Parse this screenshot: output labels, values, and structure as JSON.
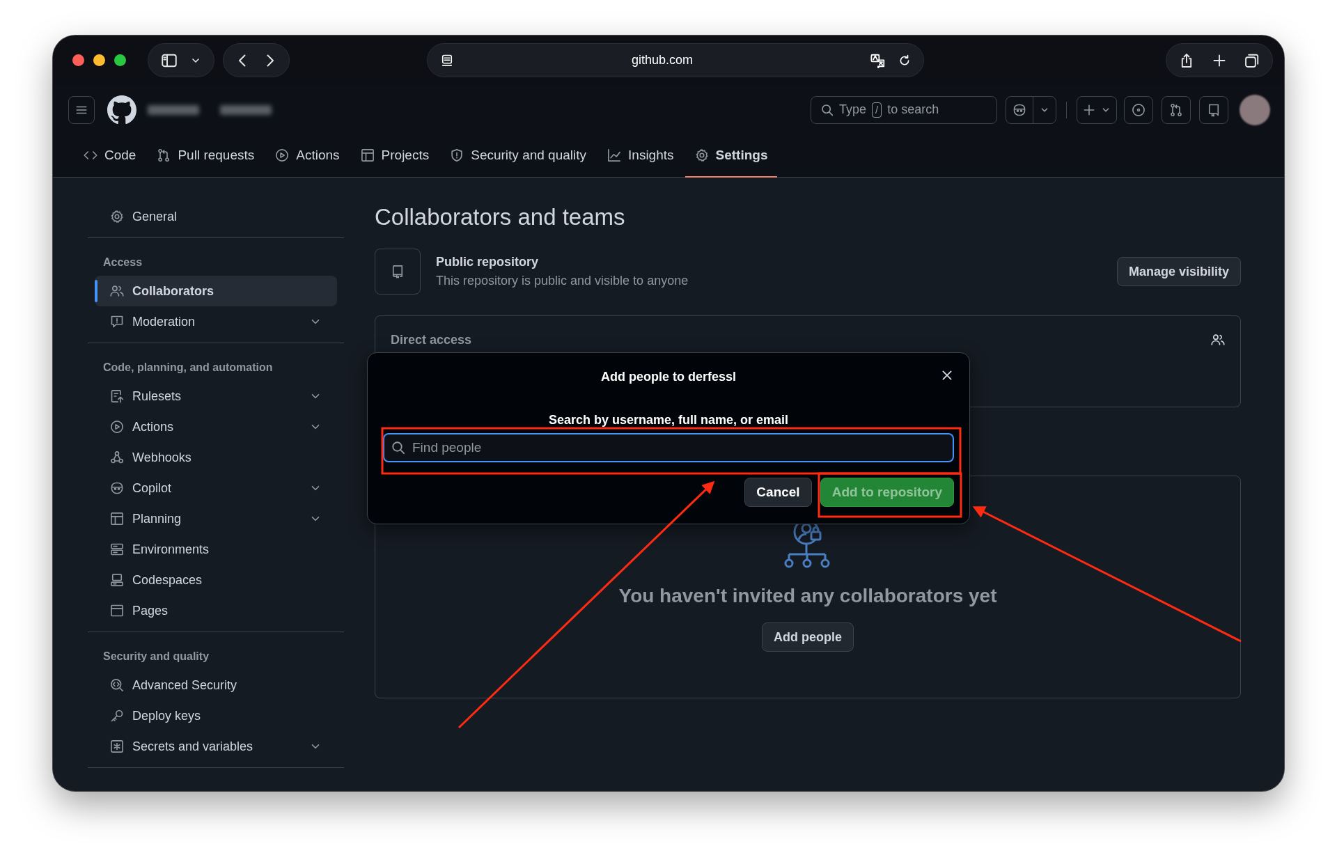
{
  "browser": {
    "url": "github.com"
  },
  "header": {
    "search": {
      "before": "Type",
      "key": "/",
      "after": "to search"
    }
  },
  "repo_nav": [
    {
      "label": "Code",
      "selected": false
    },
    {
      "label": "Pull requests",
      "selected": false
    },
    {
      "label": "Actions",
      "selected": false
    },
    {
      "label": "Projects",
      "selected": false
    },
    {
      "label": "Security and quality",
      "selected": false
    },
    {
      "label": "Insights",
      "selected": false
    },
    {
      "label": "Settings",
      "selected": true
    }
  ],
  "sidebar": {
    "sections": [
      {
        "items": [
          {
            "label": "General",
            "selected": false,
            "has_submenu": false
          }
        ]
      },
      {
        "heading": "Access",
        "items": [
          {
            "label": "Collaborators",
            "selected": true,
            "has_submenu": false
          },
          {
            "label": "Moderation",
            "selected": false,
            "has_submenu": true
          }
        ]
      },
      {
        "heading": "Code, planning, and automation",
        "items": [
          {
            "label": "Rulesets",
            "selected": false,
            "has_submenu": true
          },
          {
            "label": "Actions",
            "selected": false,
            "has_submenu": true
          },
          {
            "label": "Webhooks",
            "selected": false,
            "has_submenu": false
          },
          {
            "label": "Copilot",
            "selected": false,
            "has_submenu": true
          },
          {
            "label": "Planning",
            "selected": false,
            "has_submenu": true
          },
          {
            "label": "Environments",
            "selected": false,
            "has_submenu": false
          },
          {
            "label": "Codespaces",
            "selected": false,
            "has_submenu": false
          },
          {
            "label": "Pages",
            "selected": false,
            "has_submenu": false
          }
        ]
      },
      {
        "heading": "Security and quality",
        "items": [
          {
            "label": "Advanced Security",
            "selected": false,
            "has_submenu": false
          },
          {
            "label": "Deploy keys",
            "selected": false,
            "has_submenu": false
          },
          {
            "label": "Secrets and variables",
            "selected": false,
            "has_submenu": true
          }
        ]
      }
    ]
  },
  "main": {
    "title": "Collaborators and teams",
    "visibility": {
      "title": "Public repository",
      "description": "This repository is public and visible to anyone",
      "button": "Manage visibility"
    },
    "direct_access": {
      "heading": "Direct access"
    },
    "manage_access": {
      "empty_message": "You haven't invited any collaborators yet",
      "button": "Add people"
    }
  },
  "dialog": {
    "title": "Add people to derfessl",
    "label": "Search by username, full name, or email",
    "placeholder": "Find people",
    "buttons": [
      {
        "label": "Cancel",
        "kind": "secondary",
        "disabled": false
      },
      {
        "label": "Add to repository",
        "kind": "primary",
        "disabled": true
      }
    ]
  }
}
